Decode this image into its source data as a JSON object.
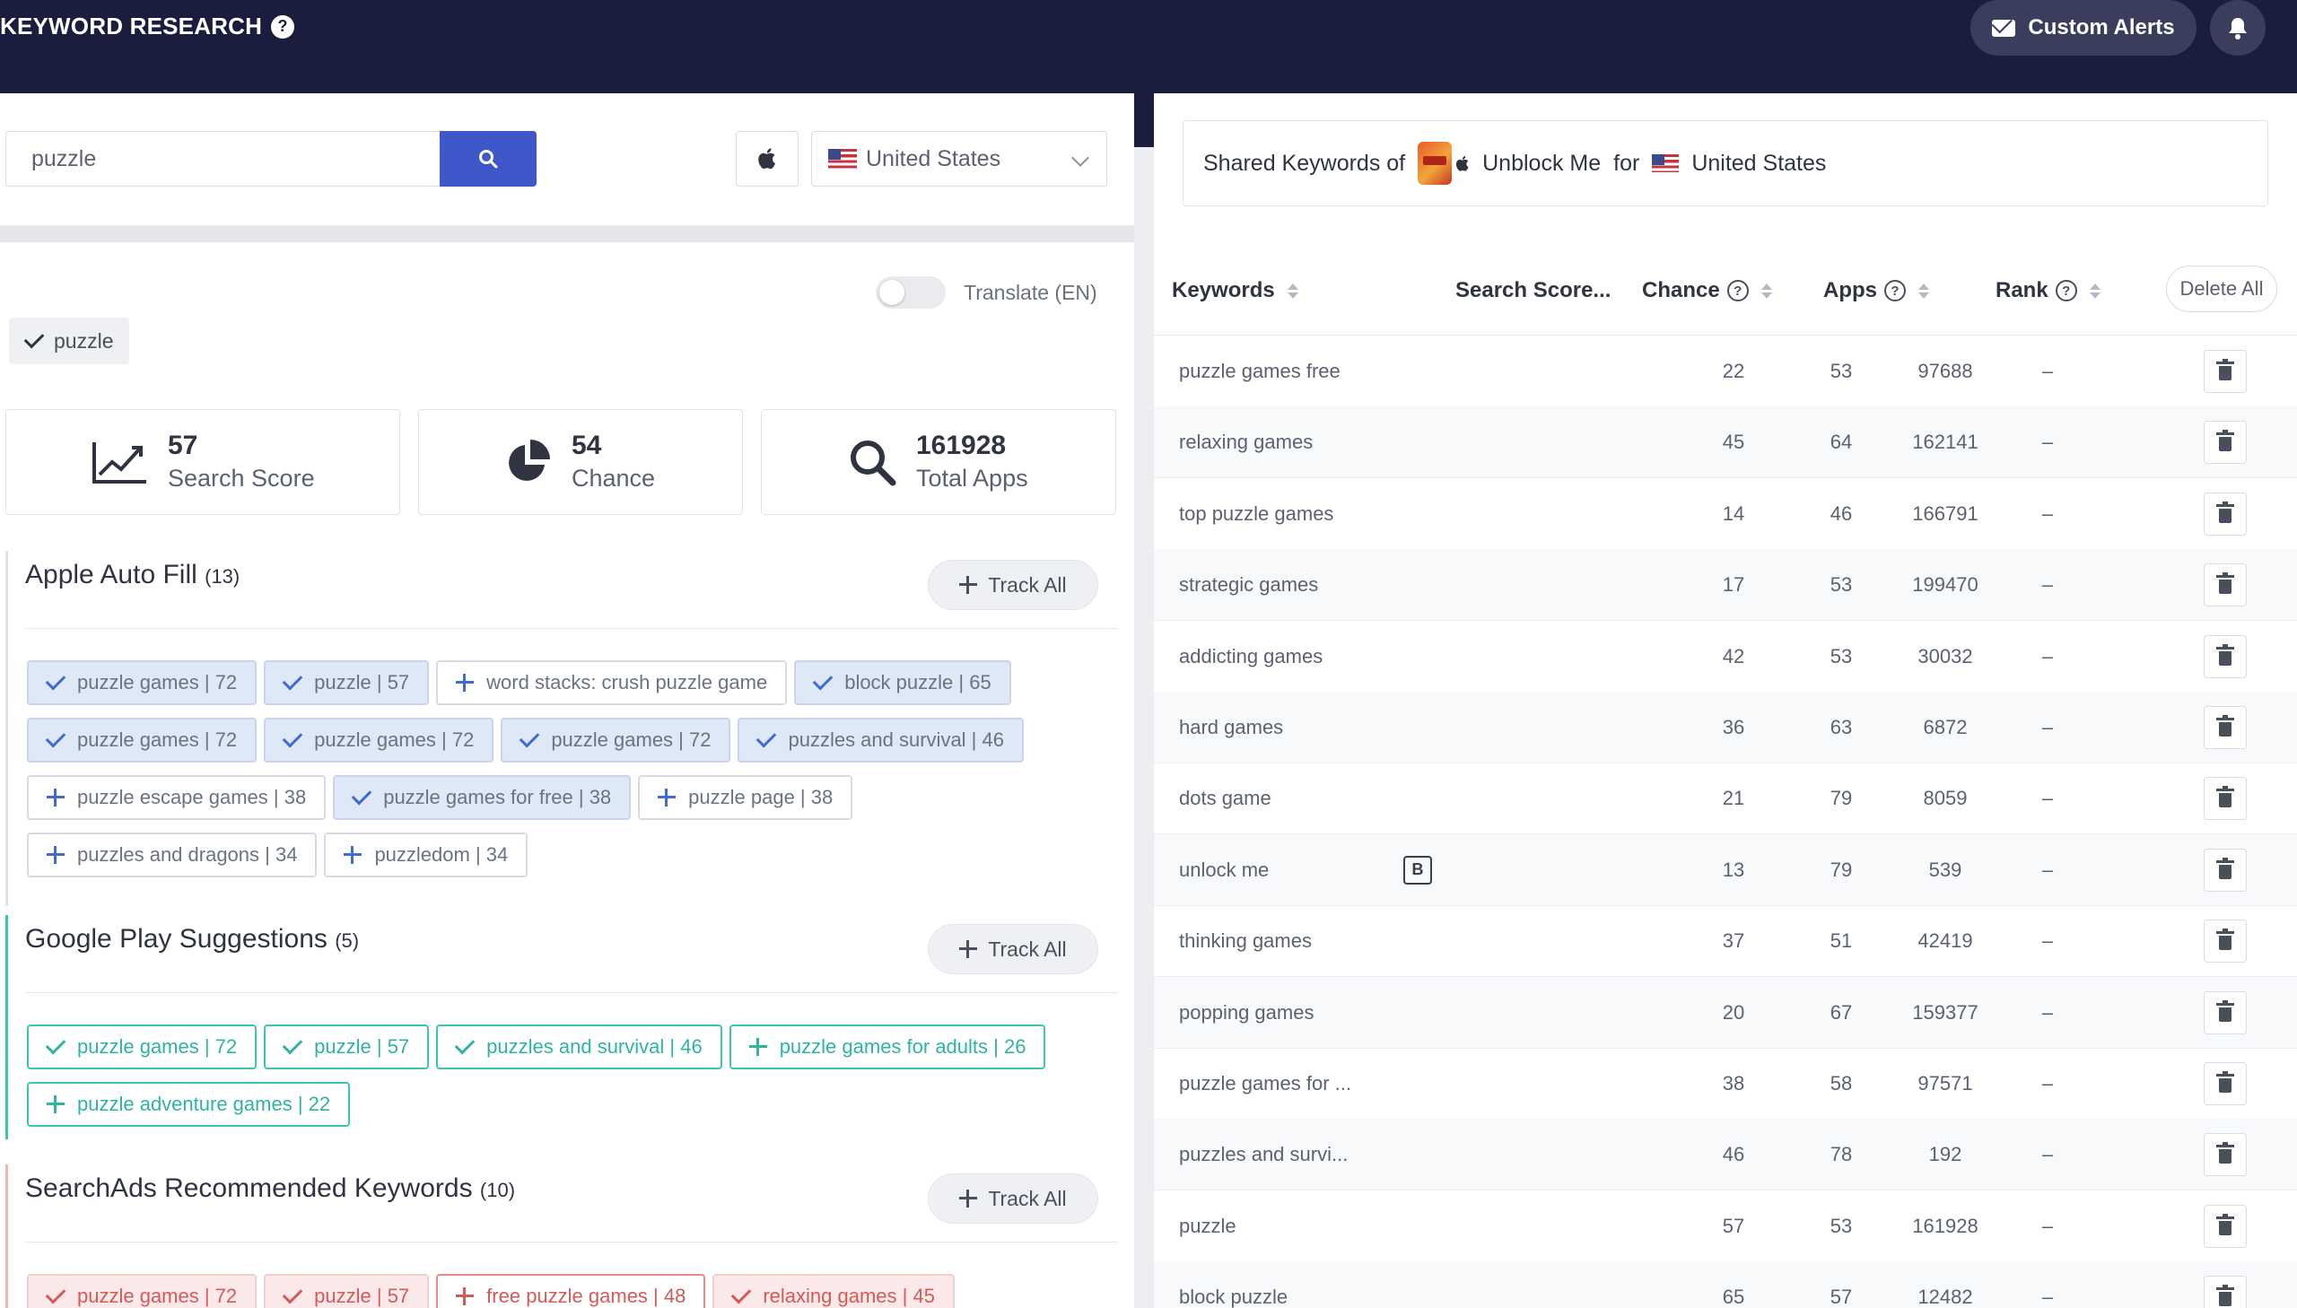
{
  "header": {
    "title": "KEYWORD RESEARCH",
    "help_icon": "question-circle-icon",
    "custom_alerts_label": "Custom Alerts"
  },
  "search": {
    "query": "puzzle",
    "country": "United States"
  },
  "translate": {
    "label": "Translate (EN)",
    "enabled": false
  },
  "selected_keyword": "puzzle",
  "stats": {
    "search_score": {
      "value": "57",
      "label": "Search Score"
    },
    "chance": {
      "value": "54",
      "label": "Chance"
    },
    "total_apps": {
      "value": "161928",
      "label": "Total Apps"
    }
  },
  "sections": {
    "apple": {
      "title": "Apple Auto Fill",
      "count": "(13)",
      "track_all": "Track All",
      "chips": [
        {
          "label": "puzzle games | 72",
          "state": "checked"
        },
        {
          "label": "puzzle | 57",
          "state": "checked"
        },
        {
          "label": "word stacks: crush puzzle game",
          "state": "add"
        },
        {
          "label": "block puzzle | 65",
          "state": "checked"
        },
        {
          "label": "puzzle games | 72",
          "state": "checked"
        },
        {
          "label": "puzzle games | 72",
          "state": "checked"
        },
        {
          "label": "puzzle games | 72",
          "state": "checked"
        },
        {
          "label": "puzzles and survival | 46",
          "state": "checked"
        },
        {
          "label": "puzzle escape games | 38",
          "state": "add"
        },
        {
          "label": "puzzle games for free | 38",
          "state": "checked"
        },
        {
          "label": "puzzle page | 38",
          "state": "add"
        },
        {
          "label": "puzzles and dragons | 34",
          "state": "add"
        },
        {
          "label": "puzzledom | 34",
          "state": "add"
        }
      ]
    },
    "google": {
      "title": "Google Play Suggestions",
      "count": "(5)",
      "track_all": "Track All",
      "chips": [
        {
          "label": "puzzle games | 72",
          "state": "checked"
        },
        {
          "label": "puzzle | 57",
          "state": "checked"
        },
        {
          "label": "puzzles and survival | 46",
          "state": "checked"
        },
        {
          "label": "puzzle games for adults | 26",
          "state": "add"
        },
        {
          "label": "puzzle adventure games | 22",
          "state": "add"
        }
      ]
    },
    "searchads": {
      "title": "SearchAds Recommended Keywords",
      "count": "(10)",
      "track_all": "Track All",
      "chips": [
        {
          "label": "puzzle games | 72",
          "state": "checked"
        },
        {
          "label": "puzzle | 57",
          "state": "checked"
        },
        {
          "label": "free puzzle games | 48",
          "state": "add"
        },
        {
          "label": "relaxing games | 45",
          "state": "checked"
        }
      ]
    }
  },
  "shared": {
    "prefix": "Shared Keywords of",
    "app_name": "Unblock Me",
    "for_label": "for",
    "country": "United States"
  },
  "table": {
    "headers": {
      "keywords": "Keywords",
      "search_score": "Search Score...",
      "chance": "Chance",
      "apps": "Apps",
      "rank": "Rank"
    },
    "delete_all": "Delete All",
    "rows": [
      {
        "keyword": "puzzle games free",
        "score": "22",
        "chance": "53",
        "apps": "97688",
        "rank": "–"
      },
      {
        "keyword": "relaxing games",
        "score": "45",
        "chance": "64",
        "apps": "162141",
        "rank": "–"
      },
      {
        "keyword": "top puzzle games",
        "score": "14",
        "chance": "46",
        "apps": "166791",
        "rank": "–"
      },
      {
        "keyword": "strategic games",
        "score": "17",
        "chance": "53",
        "apps": "199470",
        "rank": "–"
      },
      {
        "keyword": "addicting games",
        "score": "42",
        "chance": "53",
        "apps": "30032",
        "rank": "–"
      },
      {
        "keyword": "hard games",
        "score": "36",
        "chance": "63",
        "apps": "6872",
        "rank": "–"
      },
      {
        "keyword": "dots game",
        "score": "21",
        "chance": "79",
        "apps": "8059",
        "rank": "–"
      },
      {
        "keyword": "unlock me",
        "score": "13",
        "chance": "79",
        "apps": "539",
        "rank": "–",
        "badge": "B"
      },
      {
        "keyword": "thinking games",
        "score": "37",
        "chance": "51",
        "apps": "42419",
        "rank": "–"
      },
      {
        "keyword": "popping games",
        "score": "20",
        "chance": "67",
        "apps": "159377",
        "rank": "–"
      },
      {
        "keyword": "puzzle games for ...",
        "score": "38",
        "chance": "58",
        "apps": "97571",
        "rank": "–"
      },
      {
        "keyword": "puzzles and survi...",
        "score": "46",
        "chance": "78",
        "apps": "192",
        "rank": "–"
      },
      {
        "keyword": "puzzle",
        "score": "57",
        "chance": "53",
        "apps": "161928",
        "rank": "–"
      },
      {
        "keyword": "block puzzle",
        "score": "65",
        "chance": "57",
        "apps": "12482",
        "rank": "–"
      }
    ]
  },
  "colors": {
    "topbar": "#1a1d3e",
    "search_button": "#3e57c9",
    "chip_checked_bg": "#dfe8f6",
    "google_accent": "#2fb49d",
    "searchads_accent": "#d45a5a"
  }
}
